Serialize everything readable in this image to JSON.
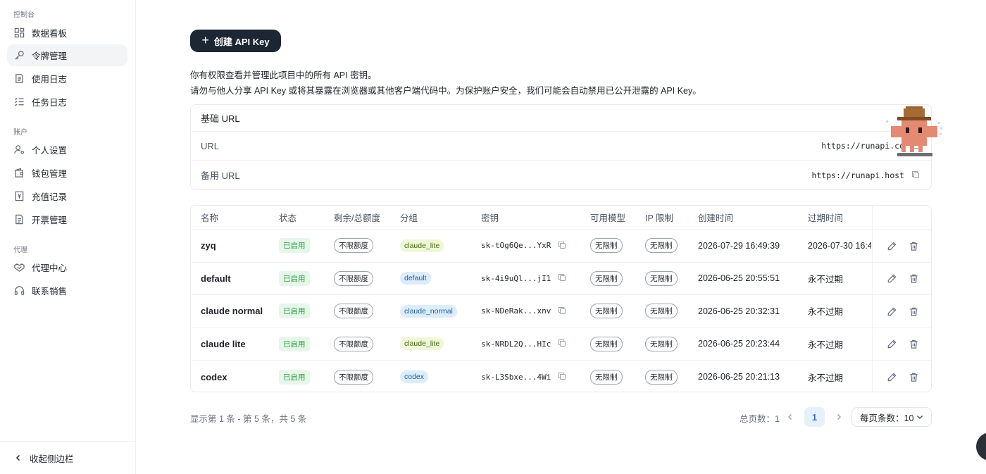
{
  "sidebar": {
    "sections": [
      "控制台",
      "账户",
      "代理"
    ],
    "items": [
      {
        "label": "数据看板",
        "icon": "dashboard-icon"
      },
      {
        "label": "令牌管理",
        "icon": "key-icon"
      },
      {
        "label": "使用日志",
        "icon": "log-icon"
      },
      {
        "label": "任务日志",
        "icon": "task-list-icon"
      },
      {
        "label": "个人设置",
        "icon": "user-settings-icon"
      },
      {
        "label": "钱包管理",
        "icon": "wallet-icon"
      },
      {
        "label": "充值记录",
        "icon": "receipt-icon"
      },
      {
        "label": "开票管理",
        "icon": "invoice-icon"
      },
      {
        "label": "代理中心",
        "icon": "handshake-icon"
      },
      {
        "label": "联系销售",
        "icon": "headset-icon"
      }
    ],
    "collapse_label": "收起侧边栏"
  },
  "main": {
    "create_button": "创建 API Key",
    "desc_line1": "你有权限查看并管理此项目中的所有 API 密钥。",
    "desc_line2": "请勿与他人分享 API Key 或将其暴露在浏览器或其他客户端代码中。为保护账户安全，我们可能会自动禁用已公开泄露的 API Key。",
    "base_url": {
      "title": "基础 URL",
      "rows": [
        {
          "label": "URL",
          "value": "https://runapi.co"
        },
        {
          "label": "备用 URL",
          "value": "https://runapi.host"
        }
      ]
    },
    "table": {
      "columns": [
        "名称",
        "状态",
        "剩余/总额度",
        "分组",
        "密钥",
        "可用模型",
        "IP 限制",
        "创建时间",
        "过期时间"
      ],
      "rows": [
        {
          "name": "zyq",
          "status": "已启用",
          "quota": "不限额度",
          "group": "claude_lite",
          "key": "sk-tOg6Qe...YxR",
          "models": "无限制",
          "ip": "无限制",
          "created": "2026-07-29 16:49:39",
          "expires": "2026-07-30 16:4"
        },
        {
          "name": "default",
          "status": "已启用",
          "quota": "不限额度",
          "group": "default",
          "key": "sk-4i9uQl...jI1",
          "models": "无限制",
          "ip": "无限制",
          "created": "2026-06-25 20:55:51",
          "expires": "永不过期"
        },
        {
          "name": "claude normal",
          "status": "已启用",
          "quota": "不限额度",
          "group": "claude_normal",
          "key": "sk-NDeRak...xnv",
          "models": "无限制",
          "ip": "无限制",
          "created": "2026-06-25 20:32:31",
          "expires": "永不过期"
        },
        {
          "name": "claude lite",
          "status": "已启用",
          "quota": "不限额度",
          "group": "claude_lite",
          "key": "sk-NRDL2Q...HIc",
          "models": "无限制",
          "ip": "无限制",
          "created": "2026-06-25 20:23:44",
          "expires": "永不过期"
        },
        {
          "name": "codex",
          "status": "已启用",
          "quota": "不限额度",
          "group": "codex",
          "key": "sk-L3Sbxe...4Wi",
          "models": "无限制",
          "ip": "无限制",
          "created": "2026-06-25 20:21:13",
          "expires": "永不过期"
        }
      ]
    }
  },
  "pagination": {
    "summary": "显示第 1 条 - 第 5 条，共 5 条",
    "total_pages": "总页数：1",
    "current_page": "1",
    "page_size": "每页条数：10"
  },
  "colors": {
    "primary_button": "#1c2733",
    "status_green": "#2ea043",
    "group_lime": "#eef7d8",
    "group_blue": "#dcecfb",
    "current_page_bg": "#e6f1fb"
  }
}
